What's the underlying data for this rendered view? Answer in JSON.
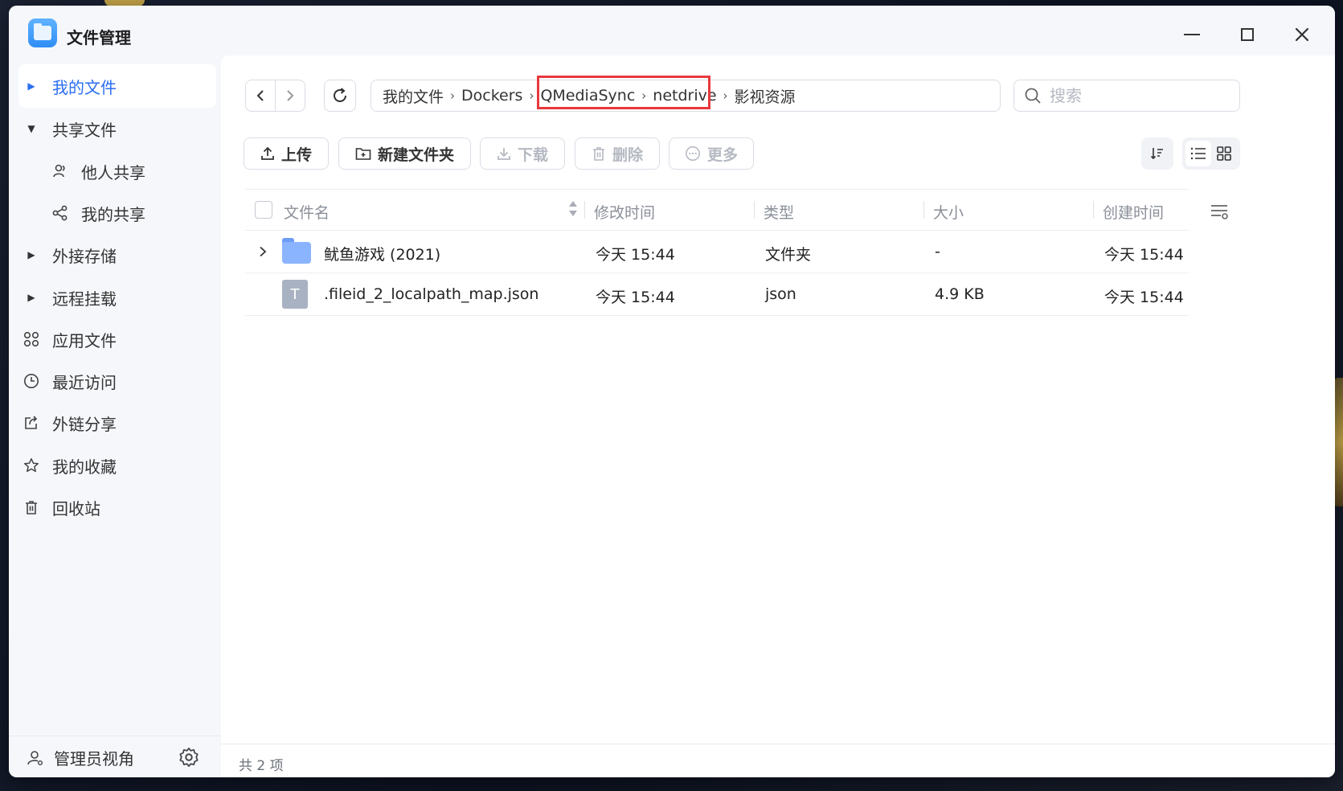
{
  "window": {
    "title": "文件管理"
  },
  "sidebar": {
    "items": [
      {
        "label": "我的文件",
        "active": true
      },
      {
        "label": "共享文件"
      },
      {
        "label": "他人共享"
      },
      {
        "label": "我的共享"
      },
      {
        "label": "外接存储"
      },
      {
        "label": "远程挂载"
      },
      {
        "label": "应用文件"
      },
      {
        "label": "最近访问"
      },
      {
        "label": "外链分享"
      },
      {
        "label": "我的收藏"
      },
      {
        "label": "回收站"
      }
    ],
    "admin_view": "管理员视角"
  },
  "breadcrumb": {
    "items": [
      "我的文件",
      "Dockers",
      "QMediaSync",
      "netdrive",
      "影视资源"
    ],
    "highlight_color": "#e8383d"
  },
  "search": {
    "placeholder": "搜索"
  },
  "toolbar": {
    "upload": "上传",
    "new_folder": "新建文件夹",
    "download": "下载",
    "delete": "删除",
    "more": "更多"
  },
  "table": {
    "columns": [
      "文件名",
      "修改时间",
      "类型",
      "大小",
      "创建时间"
    ],
    "rows": [
      {
        "name": "鱿鱼游戏 (2021)",
        "modified": "今天 15:44",
        "type": "文件夹",
        "size": "-",
        "created": "今天 15:44",
        "icon": "folder-icon"
      },
      {
        "name": ".fileid_2_localpath_map.json",
        "modified": "今天 15:44",
        "type": "json",
        "size": "4.9 KB",
        "created": "今天 15:44",
        "icon": "text-file-icon"
      }
    ]
  },
  "status": {
    "count_text": "共 2 项"
  },
  "colors": {
    "accent": "#2b6ef0",
    "folder": "#8ab4ff"
  }
}
